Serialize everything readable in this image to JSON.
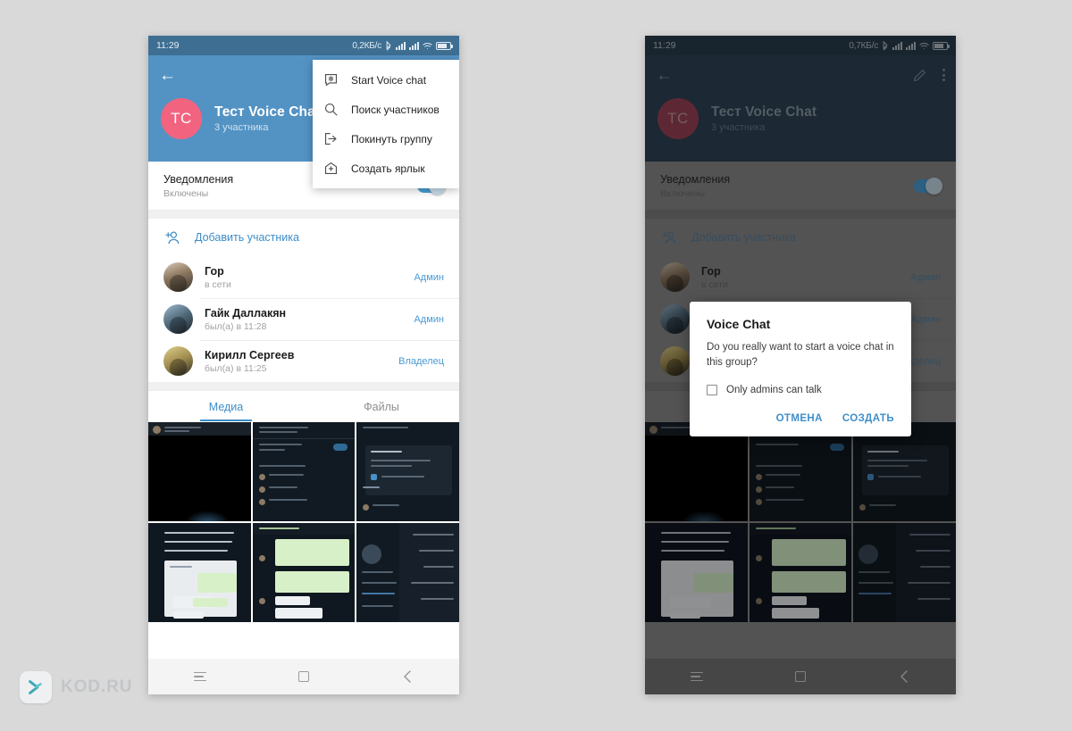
{
  "watermark": {
    "text": "KOD.RU",
    "logo_icon": "chevron-logo-icon"
  },
  "phones": {
    "left": {
      "statusbar": {
        "time": "11:29",
        "speed": "0,2КБ/с",
        "bluetooth_icon": "bluetooth-icon",
        "signal_icon": "signal-bars-icon",
        "wifi_icon": "wifi-icon",
        "battery_icon": "battery-icon"
      },
      "header": {
        "back_icon": "back-arrow-icon",
        "avatar_initials": "ТС",
        "title": "Тест Voice Chat",
        "subtitle": "3 участника",
        "avatar_color": "#f2637f",
        "bg_color": "#5393c4"
      },
      "notifications": {
        "title": "Уведомления",
        "subtitle": "Включены",
        "toggle_state": "on"
      },
      "add_member": {
        "label": "Добавить участника",
        "icon": "add-person-icon"
      },
      "members": [
        {
          "name": "Гор",
          "status": "в сети",
          "role": "Админ"
        },
        {
          "name": "Гайк Даллакян",
          "status": "был(а) в 11:28",
          "role": "Админ"
        },
        {
          "name": "Кирилл Сергеев",
          "status": "был(а) в 11:25",
          "role": "Владелец"
        }
      ],
      "tabs": [
        {
          "label": "Медиа",
          "active": true
        },
        {
          "label": "Файлы",
          "active": false
        }
      ],
      "popup_menu": [
        {
          "label": "Start Voice chat",
          "icon": "voice-chat-icon"
        },
        {
          "label": "Поиск участников",
          "icon": "search-icon"
        },
        {
          "label": "Покинуть группу",
          "icon": "exit-icon"
        },
        {
          "label": "Создать ярлык",
          "icon": "add-shortcut-icon"
        }
      ],
      "navbar": {
        "menu_icon": "hamburger-icon",
        "home_icon": "home-square-icon",
        "back_icon": "back-chevron-icon"
      }
    },
    "right": {
      "statusbar": {
        "time": "11:29",
        "speed": "0,7КБ/с",
        "bluetooth_icon": "bluetooth-icon",
        "signal_icon": "signal-bars-icon",
        "wifi_icon": "wifi-icon",
        "battery_icon": "battery-icon"
      },
      "header": {
        "back_icon": "back-arrow-icon",
        "edit_icon": "pencil-icon",
        "overflow_icon": "more-vertical-icon",
        "avatar_initials": "ТС",
        "title": "Тест Voice Chat",
        "subtitle": "3 участника"
      },
      "notifications": {
        "title": "Уведомления",
        "subtitle": "Включены",
        "toggle_state": "on"
      },
      "add_member": {
        "label": "Добавить участника",
        "icon": "add-person-icon"
      },
      "members": [
        {
          "name": "Гор",
          "status": "в сети",
          "role": "Админ"
        },
        {
          "name": "Гайк Даллакян",
          "status": "был(а) в 11:28",
          "role": "Админ"
        },
        {
          "name": "Кирилл Сергеев",
          "status": "был(а) в 11:25",
          "role": "Владелец"
        }
      ],
      "tabs": [
        {
          "label": "Медиа",
          "active": true
        },
        {
          "label": "Файлы",
          "active": false
        }
      ],
      "dialog": {
        "title": "Voice Chat",
        "message": "Do you really want to start a voice chat in this group?",
        "checkbox_label": "Only admins can talk",
        "checkbox_checked": false,
        "cancel_label": "ОТМЕНА",
        "confirm_label": "СОЗДАТЬ",
        "action_color": "#3f8fca"
      },
      "navbar": {
        "menu_icon": "hamburger-icon",
        "home_icon": "home-square-icon",
        "back_icon": "back-chevron-icon"
      }
    }
  }
}
